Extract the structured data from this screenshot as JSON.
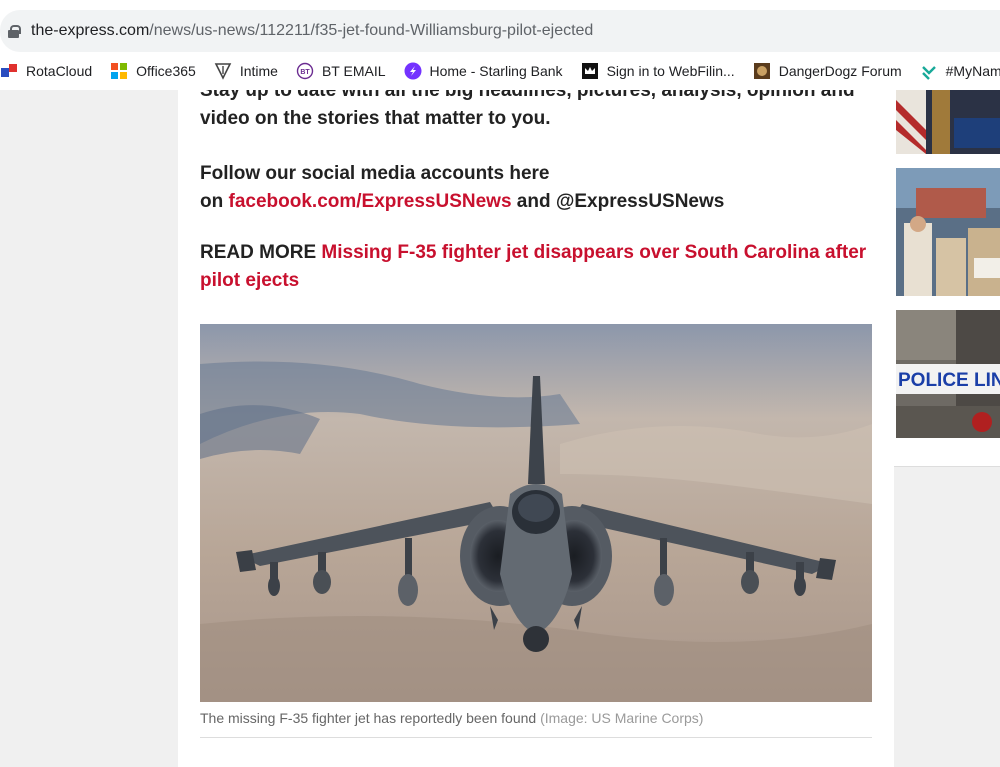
{
  "browser": {
    "url_host": "the-express.com",
    "url_path": "/news/us-news/112211/f35-jet-found-Williamsburg-pilot-ejected",
    "bookmarks": [
      {
        "label": "RotaCloud",
        "icon": "rotacloud-icon"
      },
      {
        "label": "Office365",
        "icon": "office365-icon"
      },
      {
        "label": "Intime",
        "icon": "intime-icon"
      },
      {
        "label": "BT EMAIL",
        "icon": "bt-icon"
      },
      {
        "label": "Home - Starling Bank",
        "icon": "starling-icon"
      },
      {
        "label": "Sign in to WebFilin...",
        "icon": "crown-icon"
      },
      {
        "label": "DangerDogz Forum",
        "icon": "dangerdogz-icon"
      },
      {
        "label": "#MyNamel",
        "icon": "mynamel-icon"
      }
    ]
  },
  "article": {
    "intro_line1": "Stay up to date with all the big headlines, pictures, analysis, opinion and",
    "intro_line2": "video on the stories that matter to you.",
    "follow_prefix": "Follow our social media accounts here",
    "follow_on": "on ",
    "facebook_link": "facebook.com/ExpressUSNews",
    "follow_and": " and @ExpressUSNews",
    "read_more_label": "READ MORE ",
    "read_more_link": "Missing F-35 fighter jet disappears over South Carolina after pilot ejects",
    "caption": "The missing F-35 fighter jet has reportedly been found",
    "caption_credit": "(Image: US Marine Corps)"
  },
  "rail": {
    "thumb3_text": "POLICE LINE D"
  },
  "colors": {
    "link_red": "#c8102e",
    "text": "#222222"
  }
}
